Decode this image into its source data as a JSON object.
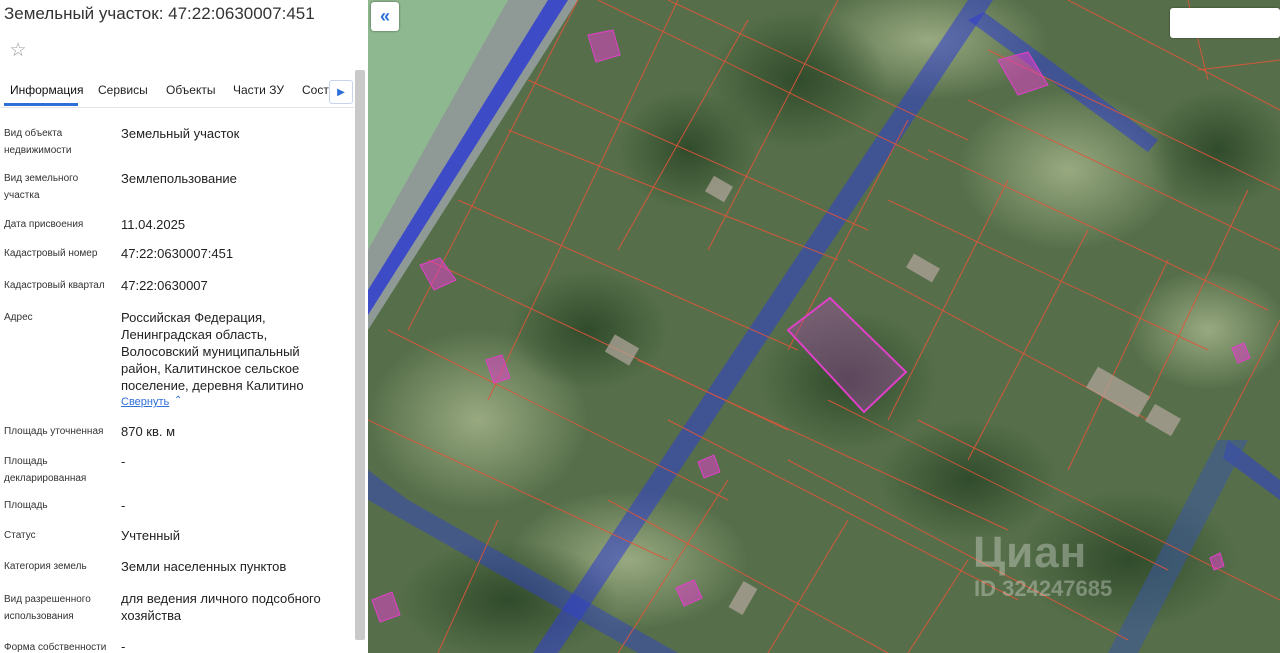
{
  "header": {
    "title": "Земельный участок: 47:22:0630007:451",
    "star_icon": "star-outline-icon"
  },
  "tabs": [
    {
      "label": "Информация",
      "active": true
    },
    {
      "label": "Сервисы"
    },
    {
      "label": "Объекты"
    },
    {
      "label": "Части ЗУ"
    },
    {
      "label": "Состав"
    }
  ],
  "tabs_next_icon": "chevron-right-icon",
  "fields": [
    {
      "label": "Вид объекта недвижимости",
      "value": "Земельный участок"
    },
    {
      "label": "Вид земельного участка",
      "value": "Землепользование"
    },
    {
      "label": "Дата присвоения",
      "value": "11.04.2025"
    },
    {
      "label": "Кадастровый номер",
      "value": "47:22:0630007:451"
    },
    {
      "label": "Кадастровый квартал",
      "value": "47:22:0630007"
    },
    {
      "label": "Адрес",
      "value": "Российская Федерация, Ленинградская область, Волосовский муниципальный район, Калитинское сельское поселение, деревня Калитино"
    },
    {
      "label": "Площадь уточненная",
      "value": "870 кв. м"
    },
    {
      "label": "Площадь декларированная",
      "value": "-"
    },
    {
      "label": "Площадь",
      "value": "-"
    },
    {
      "label": "Статус",
      "value": "Учтенный"
    },
    {
      "label": "Категория земель",
      "value": "Земли населенных пунктов"
    },
    {
      "label": "Вид разрешенного использования",
      "value": "для ведения личного подсобного хозяйства"
    },
    {
      "label": "Форма собственности",
      "value": "-"
    }
  ],
  "address_collapse": {
    "label": "Свернуть",
    "icon": "chevron-up-icon"
  },
  "map": {
    "collapse_icon": "double-chevron-left-icon",
    "watermark": "Циан",
    "watermark_id": "ID 324247685",
    "colors": {
      "parcel_line": "#e0553a",
      "road": "#2f3dd0",
      "highlight": "#e040c8"
    }
  }
}
